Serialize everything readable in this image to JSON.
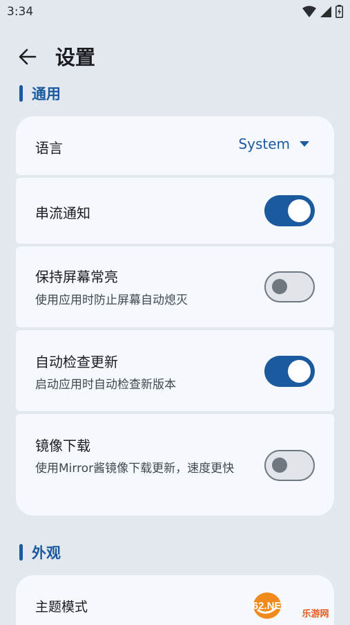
{
  "status_bar": {
    "time": "3:34"
  },
  "header": {
    "title": "设置"
  },
  "sections": {
    "general": {
      "title": "通用"
    },
    "appearance": {
      "title": "外观"
    }
  },
  "settings": {
    "language": {
      "label": "语言",
      "value": "System"
    },
    "stream_notification": {
      "label": "串流通知",
      "enabled": true
    },
    "keep_screen_on": {
      "label": "保持屏幕常亮",
      "description": "使用应用时防止屏幕自动熄灭",
      "enabled": false
    },
    "auto_update_check": {
      "label": "自动检查更新",
      "description": "启动应用时自动检查新版本",
      "enabled": true
    },
    "mirror_download": {
      "label": "镜像下载",
      "description": "使用Mirror酱镜像下载更新，速度更快",
      "enabled": false
    },
    "theme_mode": {
      "label": "主题模式"
    }
  },
  "watermark": {
    "text_top": "962.NET",
    "text_bottom": "乐游网"
  },
  "colors": {
    "accent": "#1c5aa0",
    "background": "#e2e8ee",
    "card": "#f5f9fd"
  }
}
